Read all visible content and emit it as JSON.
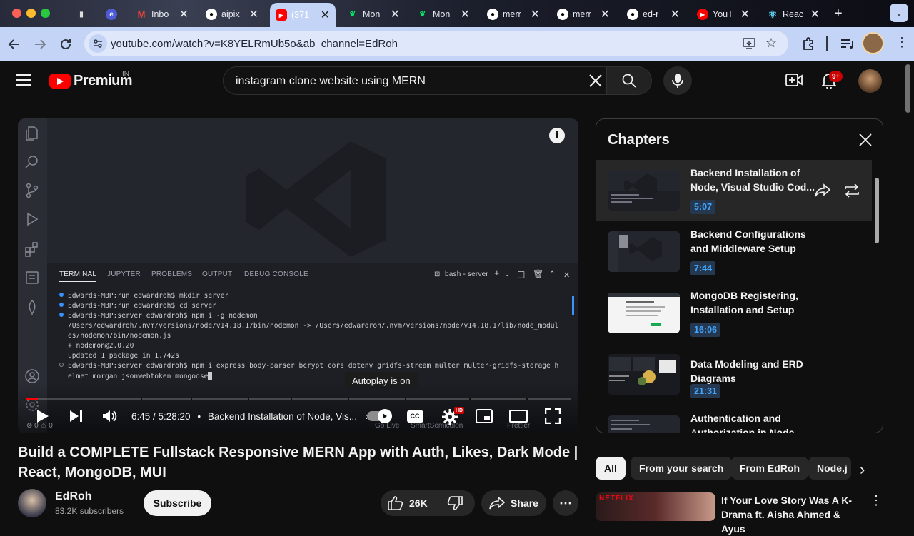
{
  "browser": {
    "tabs": [
      {
        "label": "",
        "icon": "pin-icon",
        "color": "#2c2c2c"
      },
      {
        "label": "",
        "icon": "app-icon",
        "color": "#4f5bd5"
      },
      {
        "label": "Inbo",
        "icon": "gmail-icon",
        "color": "#ea4335"
      },
      {
        "label": "aipix",
        "icon": "github-icon",
        "color": "#ffffff"
      },
      {
        "label": "(371",
        "icon": "youtube-icon",
        "color": "#ff0000"
      },
      {
        "label": "Mon",
        "icon": "mongodb-icon",
        "color": "#00ed64"
      },
      {
        "label": "Mon",
        "icon": "mongodb-icon",
        "color": "#00ed64"
      },
      {
        "label": "merr",
        "icon": "github-icon",
        "color": "#ffffff"
      },
      {
        "label": "merr",
        "icon": "github-icon",
        "color": "#ffffff"
      },
      {
        "label": "ed-r",
        "icon": "github-icon",
        "color": "#ffffff"
      },
      {
        "label": "YouT",
        "icon": "youtube-icon",
        "color": "#ff0000"
      },
      {
        "label": "Reac",
        "icon": "react-icon",
        "color": "#61dafb"
      }
    ],
    "url": "youtube.com/watch?v=K8YELRmUb5o&ab_channel=EdRoh"
  },
  "youtube": {
    "logo_text": "Premium",
    "region": "IN",
    "search_query": "instagram clone website using MERN",
    "notification_count": "9+"
  },
  "player": {
    "vscode": {
      "terminal_tabs": [
        "TERMINAL",
        "JUPYTER",
        "PROBLEMS",
        "OUTPUT",
        "DEBUG CONSOLE"
      ],
      "shell_label": "bash - server",
      "lines": [
        "Edwards-MBP:run edwardroh$ mkdir server",
        "Edwards-MBP:run edwardroh$ cd server",
        "Edwards-MBP:server edwardroh$ npm i -g nodemon",
        "/Users/edwardroh/.nvm/versions/node/v14.18.1/bin/nodemon -> /Users/edwardroh/.nvm/versions/node/v14.18.1/lib/node_modul",
        "es/nodemon/bin/nodemon.js",
        "+ nodemon@2.0.20",
        "updated 1 package in 1.742s",
        "Edwards-MBP:server edwardroh$ npm i express body-parser bcrypt cors dotenv gridfs-stream multer multer-gridfs-storage h",
        "elmet morgan jsonwebtoken mongoose"
      ],
      "status_left": "⊗ 0 ⚠ 0",
      "status_items": [
        "Go Live",
        "SmartSemicolon",
        "Prettier"
      ]
    },
    "autoplay_tooltip": "Autoplay is on",
    "time": "6:45 / 5:28:20",
    "chapter_in_bar": "Backend Installation of Node, Vis...",
    "progress": 0.021,
    "hd_badge": "HD",
    "cc_label": "CC"
  },
  "video": {
    "title": "Build a COMPLETE Fullstack Responsive MERN App with Auth, Likes, Dark Mode | React, MongoDB, MUI",
    "channel": "EdRoh",
    "subscribers": "83.2K subscribers",
    "subscribe_label": "Subscribe",
    "likes": "26K",
    "share_label": "Share"
  },
  "chapters": {
    "header": "Chapters",
    "items": [
      {
        "title": "Backend Installation of Node, Visual Studio Cod...",
        "time": "5:07",
        "selected": true
      },
      {
        "title": "Backend Configurations and Middleware Setup",
        "time": "7:44",
        "selected": false
      },
      {
        "title": "MongoDB Registering, Installation and Setup",
        "time": "16:06",
        "selected": false
      },
      {
        "title": "Data Modeling and ERD Diagrams",
        "time": "21:31",
        "selected": false
      },
      {
        "title": "Authentication and Authorization in Node",
        "time": "",
        "selected": false
      }
    ]
  },
  "chips": [
    "All",
    "From your search",
    "From EdRoh",
    "Node.j"
  ],
  "recommended": {
    "title": "If Your Love Story Was A K-Drama ft. Aisha Ahmed & Ayus",
    "thumb_brand": "NETFLIX"
  }
}
